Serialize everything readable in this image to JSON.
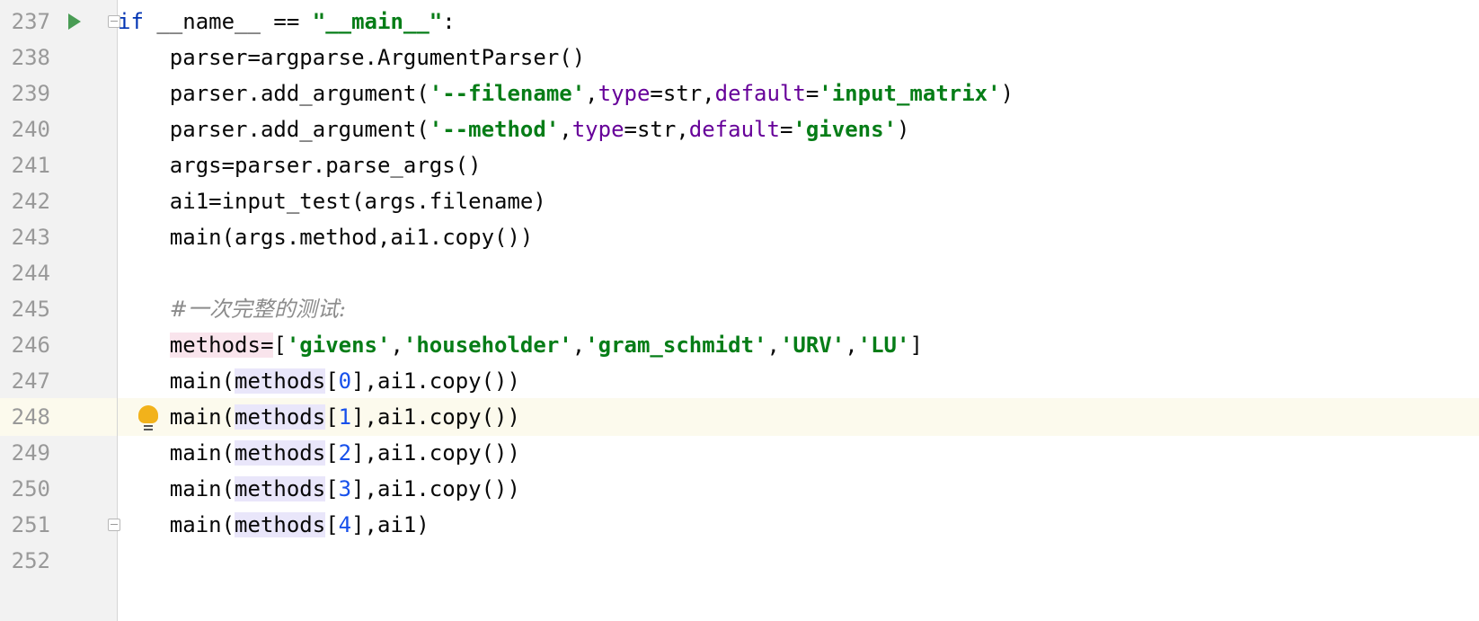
{
  "editor": {
    "current_line": "248",
    "lines": [
      {
        "no": "237",
        "tokens": [
          {
            "t": "if",
            "c": "kw"
          },
          {
            "t": " __name__ == ",
            "c": "ident"
          },
          {
            "t": "\"__main__\"",
            "c": "str"
          },
          {
            "t": ":",
            "c": "ident"
          }
        ]
      },
      {
        "no": "238",
        "tokens": [
          {
            "t": "    parser=argparse.ArgumentParser()",
            "c": "ident"
          }
        ]
      },
      {
        "no": "239",
        "tokens": [
          {
            "t": "    parser.add_argument(",
            "c": "ident"
          },
          {
            "t": "'--filename'",
            "c": "str"
          },
          {
            "t": ",",
            "c": "ident"
          },
          {
            "t": "type",
            "c": "kwarg"
          },
          {
            "t": "=str,",
            "c": "ident"
          },
          {
            "t": "default",
            "c": "kwarg"
          },
          {
            "t": "=",
            "c": "ident"
          },
          {
            "t": "'input_matrix'",
            "c": "str"
          },
          {
            "t": ")",
            "c": "ident"
          }
        ]
      },
      {
        "no": "240",
        "tokens": [
          {
            "t": "    parser.add_argument(",
            "c": "ident"
          },
          {
            "t": "'--method'",
            "c": "str"
          },
          {
            "t": ",",
            "c": "ident"
          },
          {
            "t": "type",
            "c": "kwarg"
          },
          {
            "t": "=str,",
            "c": "ident"
          },
          {
            "t": "default",
            "c": "kwarg"
          },
          {
            "t": "=",
            "c": "ident"
          },
          {
            "t": "'givens'",
            "c": "str"
          },
          {
            "t": ")",
            "c": "ident"
          }
        ]
      },
      {
        "no": "241",
        "tokens": [
          {
            "t": "    args=parser.parse_args()",
            "c": "ident"
          }
        ]
      },
      {
        "no": "242",
        "tokens": [
          {
            "t": "    ai1=input_test(args.filename)",
            "c": "ident"
          }
        ]
      },
      {
        "no": "243",
        "tokens": [
          {
            "t": "    main(args.method,ai1.copy())",
            "c": "ident"
          }
        ]
      },
      {
        "no": "244",
        "tokens": []
      },
      {
        "no": "245",
        "tokens": [
          {
            "t": "    ",
            "c": "ident"
          },
          {
            "t": "#一次完整的测试:",
            "c": "cmt"
          }
        ]
      },
      {
        "no": "246",
        "tokens": [
          {
            "t": "    ",
            "c": "ident"
          },
          {
            "t": "methods=",
            "c": "ident",
            "hl": "def"
          },
          {
            "t": "[",
            "c": "ident"
          },
          {
            "t": "'givens'",
            "c": "str"
          },
          {
            "t": ",",
            "c": "ident"
          },
          {
            "t": "'householder'",
            "c": "str"
          },
          {
            "t": ",",
            "c": "ident"
          },
          {
            "t": "'gram_schmidt'",
            "c": "str"
          },
          {
            "t": ",",
            "c": "ident"
          },
          {
            "t": "'URV'",
            "c": "str"
          },
          {
            "t": ",",
            "c": "ident"
          },
          {
            "t": "'LU'",
            "c": "str"
          },
          {
            "t": "]",
            "c": "ident"
          }
        ]
      },
      {
        "no": "247",
        "tokens": [
          {
            "t": "    main(",
            "c": "ident"
          },
          {
            "t": "methods",
            "c": "ident",
            "hl": "ref"
          },
          {
            "t": "[",
            "c": "ident"
          },
          {
            "t": "0",
            "c": "num"
          },
          {
            "t": "],ai1.copy())",
            "c": "ident"
          }
        ]
      },
      {
        "no": "248",
        "tokens": [
          {
            "t": "    main(",
            "c": "ident"
          },
          {
            "t": "methods",
            "c": "ident",
            "hl": "ref"
          },
          {
            "t": "[",
            "c": "ident"
          },
          {
            "t": "1",
            "c": "num"
          },
          {
            "t": "],ai1.copy())",
            "c": "ident"
          }
        ]
      },
      {
        "no": "249",
        "tokens": [
          {
            "t": "    main(",
            "c": "ident"
          },
          {
            "t": "methods",
            "c": "ident",
            "hl": "ref"
          },
          {
            "t": "[",
            "c": "ident"
          },
          {
            "t": "2",
            "c": "num"
          },
          {
            "t": "],ai1.copy())",
            "c": "ident"
          }
        ]
      },
      {
        "no": "250",
        "tokens": [
          {
            "t": "    main(",
            "c": "ident"
          },
          {
            "t": "methods",
            "c": "ident",
            "hl": "ref"
          },
          {
            "t": "[",
            "c": "ident"
          },
          {
            "t": "3",
            "c": "num"
          },
          {
            "t": "],ai1.copy())",
            "c": "ident"
          }
        ]
      },
      {
        "no": "251",
        "tokens": [
          {
            "t": "    main(",
            "c": "ident"
          },
          {
            "t": "methods",
            "c": "ident",
            "hl": "ref"
          },
          {
            "t": "[",
            "c": "ident"
          },
          {
            "t": "4",
            "c": "num"
          },
          {
            "t": "],ai1)",
            "c": "ident"
          }
        ]
      },
      {
        "no": "252",
        "tokens": []
      }
    ],
    "gutter_icons": {
      "run": "run-icon",
      "fold_open": "fold-open-icon",
      "fold_close": "fold-close-icon",
      "intention": "intention-bulb-icon"
    },
    "colors": {
      "keyword": "#0033b3",
      "string": "#067d17",
      "kwarg": "#660099",
      "number": "#1750eb",
      "comment": "#8c8c8c",
      "current_line_bg": "#fcfaed",
      "def_highlight": "#f9e4ec",
      "ref_highlight": "#e9e6fa",
      "run_green": "#499c54",
      "bulb_yellow": "#f2b21b"
    }
  }
}
